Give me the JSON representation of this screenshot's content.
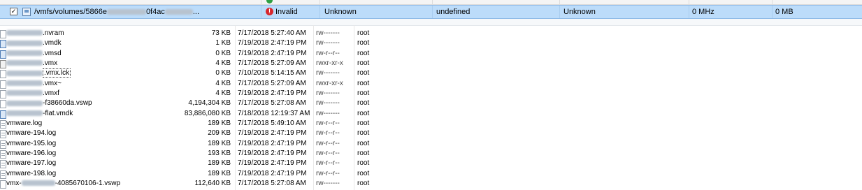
{
  "vm_row": {
    "checked": "✓",
    "path_prefix": "/vmfs/volumes/5866e",
    "path_middle": "0f4ac",
    "path_suffix": "...",
    "status_icon": "error-icon",
    "status": "Invalid",
    "os": "Unknown",
    "host": "undefined",
    "guest": "Unknown",
    "cpu": "0 MHz",
    "memory": "0 MB"
  },
  "files": [
    {
      "icon": "file-icon",
      "prefix": "",
      "name": ".nvram",
      "size": "73 KB",
      "modified": "7/17/2018 5:27:40 AM",
      "perms": "rw-------",
      "owner": "root"
    },
    {
      "icon": "disk-icon",
      "prefix": "",
      "name": ".vmdk",
      "size": "1 KB",
      "modified": "7/19/2018 2:47:19 PM",
      "perms": "rw-------",
      "owner": "root"
    },
    {
      "icon": "disk-icon",
      "prefix": "",
      "name": ".vmsd",
      "size": "0 KB",
      "modified": "7/19/2018 2:47:19 PM",
      "perms": "rw-r--r--",
      "owner": "root"
    },
    {
      "icon": "config-icon",
      "prefix": "",
      "name": ".vmx",
      "size": "4 KB",
      "modified": "7/17/2018 5:27:09 AM",
      "perms": "rwxr-xr-x",
      "owner": "root"
    },
    {
      "icon": "file-icon",
      "prefix": "",
      "name": ".vmx.lck",
      "size": "0 KB",
      "modified": "7/10/2018 5:14:15 AM",
      "perms": "rw-------",
      "owner": "root"
    },
    {
      "icon": "file-icon",
      "prefix": "",
      "name": ".vmx~",
      "size": "4 KB",
      "modified": "7/17/2018 5:27:09 AM",
      "perms": "rwxr-xr-x",
      "owner": "root"
    },
    {
      "icon": "file-icon",
      "prefix": "",
      "name": ".vmxf",
      "size": "4 KB",
      "modified": "7/19/2018 2:47:19 PM",
      "perms": "rw-------",
      "owner": "root"
    },
    {
      "icon": "file-icon",
      "prefix": "",
      "name": "-f38660da.vswp",
      "size": "4,194,304 KB",
      "modified": "7/17/2018 5:27:08 AM",
      "perms": "rw-------",
      "owner": "root"
    },
    {
      "icon": "disk-icon",
      "prefix": "",
      "name": "-flat.vmdk",
      "size": "83,886,080 KB",
      "modified": "7/18/2018 12:19:37 AM",
      "perms": "rw-------",
      "owner": "root"
    },
    {
      "icon": "log-icon",
      "prefix": "",
      "name": "vmware.log",
      "size": "189 KB",
      "modified": "7/17/2018 5:49:10 AM",
      "perms": "rw-r--r--",
      "owner": "root"
    },
    {
      "icon": "log-icon",
      "prefix": "",
      "name": "vmware-194.log",
      "size": "209 KB",
      "modified": "7/19/2018 2:47:19 PM",
      "perms": "rw-r--r--",
      "owner": "root"
    },
    {
      "icon": "log-icon",
      "prefix": "",
      "name": "vmware-195.log",
      "size": "189 KB",
      "modified": "7/19/2018 2:47:19 PM",
      "perms": "rw-r--r--",
      "owner": "root"
    },
    {
      "icon": "log-icon",
      "prefix": "",
      "name": "vmware-196.log",
      "size": "193 KB",
      "modified": "7/19/2018 2:47:19 PM",
      "perms": "rw-r--r--",
      "owner": "root"
    },
    {
      "icon": "log-icon",
      "prefix": "",
      "name": "vmware-197.log",
      "size": "189 KB",
      "modified": "7/19/2018 2:47:19 PM",
      "perms": "rw-r--r--",
      "owner": "root"
    },
    {
      "icon": "log-icon",
      "prefix": "",
      "name": "vmware-198.log",
      "size": "189 KB",
      "modified": "7/19/2018 2:47:19 PM",
      "perms": "rw-r--r--",
      "owner": "root"
    },
    {
      "icon": "file-icon",
      "prefix": "vmx-",
      "name": "-4085670106-1.vswp",
      "size": "112,640 KB",
      "modified": "7/17/2018 5:27:08 AM",
      "perms": "rw-------",
      "owner": "root"
    }
  ],
  "colors": {
    "selected_row": "#bcdcfa",
    "error": "#d8262d",
    "ok": "#2ea043"
  }
}
